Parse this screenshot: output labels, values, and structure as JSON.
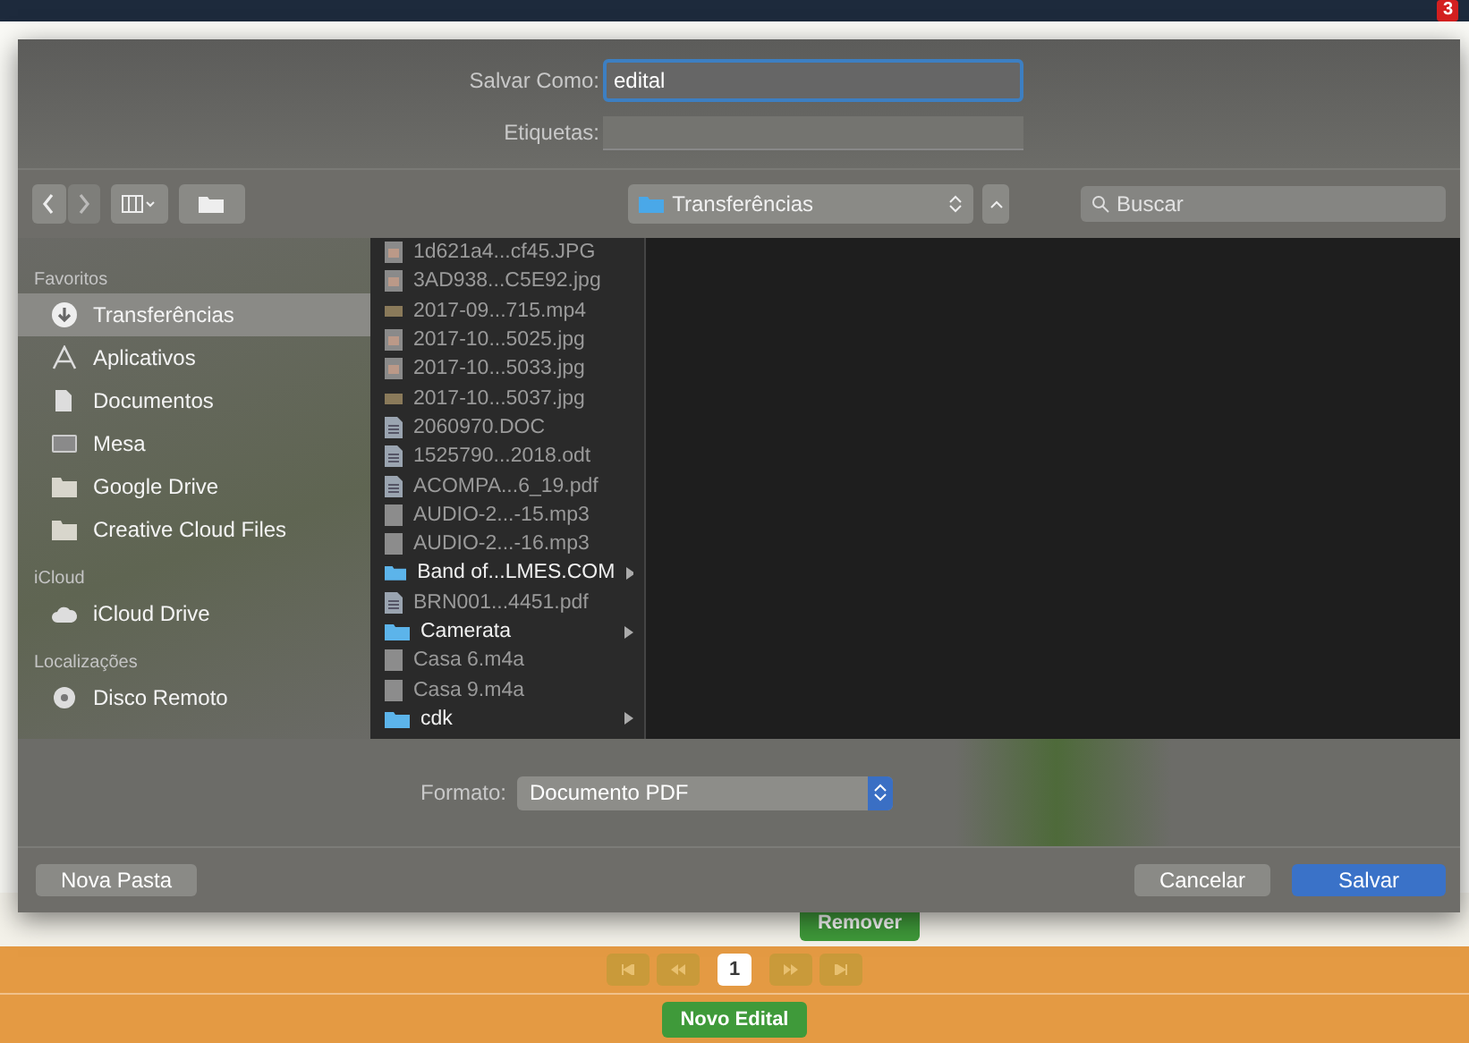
{
  "badge": "3",
  "dialog": {
    "save_as": {
      "label": "Salvar Como:",
      "value": "edital"
    },
    "tags": {
      "label": "Etiquetas:"
    },
    "location": "Transferências",
    "search": {
      "placeholder": "Buscar"
    },
    "sidebar": [
      {
        "title": "Favoritos",
        "items": [
          {
            "label": "Transferências",
            "kind": "download",
            "selected": true
          },
          {
            "label": "Aplicativos",
            "kind": "apps",
            "selected": false
          },
          {
            "label": "Documentos",
            "kind": "docs",
            "selected": false
          },
          {
            "label": "Mesa",
            "kind": "desktop",
            "selected": false
          },
          {
            "label": "Google Drive",
            "kind": "folder",
            "selected": false
          },
          {
            "label": "Creative Cloud Files",
            "kind": "folder",
            "selected": false
          }
        ]
      },
      {
        "title": "iCloud",
        "items": [
          {
            "label": "iCloud Drive",
            "kind": "cloud",
            "selected": false
          }
        ]
      },
      {
        "title": "Localizações",
        "items": [
          {
            "label": "Disco Remoto",
            "kind": "disc",
            "selected": false
          }
        ]
      }
    ],
    "files": [
      {
        "name": "1d621a4...cf45.JPG",
        "kind": "image",
        "disabled": true
      },
      {
        "name": "3AD938...C5E92.jpg",
        "kind": "image",
        "disabled": true
      },
      {
        "name": "2017-09...715.mp4",
        "kind": "video",
        "disabled": true
      },
      {
        "name": "2017-10...5025.jpg",
        "kind": "image",
        "disabled": true
      },
      {
        "name": "2017-10...5033.jpg",
        "kind": "image",
        "disabled": true
      },
      {
        "name": "2017-10...5037.jpg",
        "kind": "video",
        "disabled": true
      },
      {
        "name": "2060970.DOC",
        "kind": "doc",
        "disabled": true
      },
      {
        "name": "1525790...2018.odt",
        "kind": "doc",
        "disabled": true
      },
      {
        "name": "ACOMPA...6_19.pdf",
        "kind": "doc",
        "disabled": true
      },
      {
        "name": "AUDIO-2...-15.mp3",
        "kind": "file",
        "disabled": true
      },
      {
        "name": "AUDIO-2...-16.mp3",
        "kind": "file",
        "disabled": true
      },
      {
        "name": "Band of...LMES.COM",
        "kind": "folder",
        "disabled": false
      },
      {
        "name": "BRN001...4451.pdf",
        "kind": "doc",
        "disabled": true
      },
      {
        "name": "Camerata",
        "kind": "folder",
        "disabled": false
      },
      {
        "name": "Casa 6.m4a",
        "kind": "file",
        "disabled": true
      },
      {
        "name": "Casa 9.m4a",
        "kind": "file",
        "disabled": true
      },
      {
        "name": "cdk",
        "kind": "folder",
        "disabled": false
      }
    ],
    "format": {
      "label": "Formato:",
      "value": "Documento PDF"
    },
    "buttons": {
      "new_folder": "Nova Pasta",
      "cancel": "Cancelar",
      "save": "Salvar"
    }
  },
  "page": {
    "remove_button": "Remover",
    "pagination": [
      {
        "label": "1",
        "selected": true
      }
    ],
    "new_button": "Novo Edital"
  }
}
